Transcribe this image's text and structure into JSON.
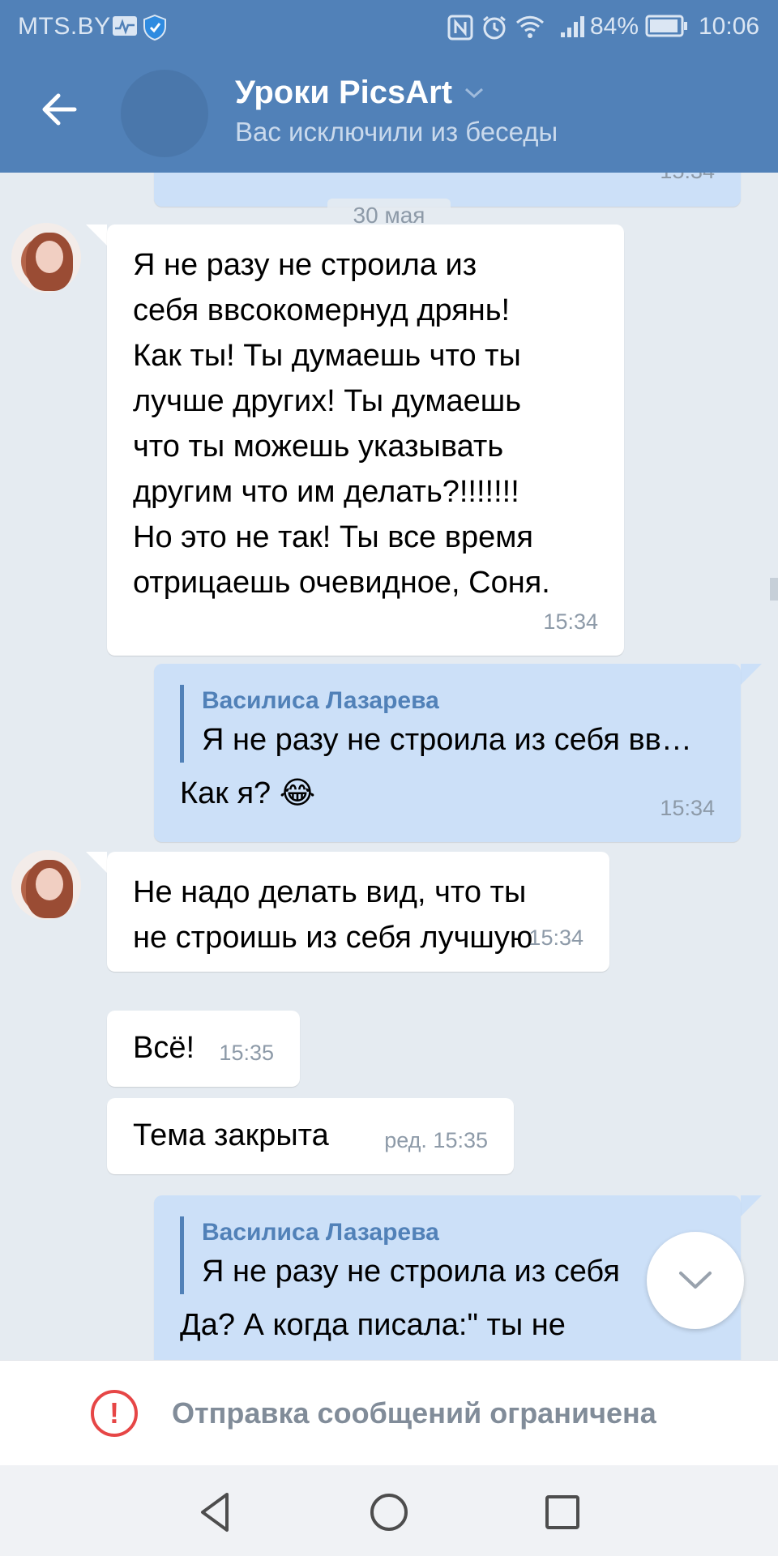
{
  "status_bar": {
    "carrier": "MTS.BY",
    "battery": "84%",
    "time": "10:06"
  },
  "header": {
    "title": "Уроки PicsArt",
    "subtitle": "Вас исключили из беседы"
  },
  "messages": {
    "prev_cut_time": "15:34",
    "date_separator": "30 мая",
    "m1": {
      "lines": [
        "Я не разу не строила из",
        "себя ввсокомернуд дрянь!",
        "Как ты! Ты думаешь что ты",
        "лучше других! Ты думаешь",
        "что ты можешь указывать",
        "другим что им делать?!!!!!!!",
        "Но это не так! Ты все время",
        "отрицаешь очевидное, Соня."
      ],
      "time": "15:34"
    },
    "m2": {
      "quote_author": "Василиса Лазарева",
      "quote_text": "Я не разу не строила из себя вв…",
      "text": "Как я? 😂",
      "time": "15:34"
    },
    "m3": {
      "lines": [
        "Не надо делать вид, что ты",
        "не строишь из себя лучшую"
      ],
      "time": "15:34"
    },
    "m4": {
      "text": "Всё!",
      "time": "15:35"
    },
    "m5": {
      "text": "Тема закрыта",
      "time": "ред. 15:35"
    },
    "m6": {
      "quote_author": "Василиса Лазарева",
      "quote_text": "Я не разу не строила из себя",
      "text": "Да? А когда писала:\" ты не"
    }
  },
  "restriction": {
    "text": "Отправка сообщений ограничена"
  },
  "colors": {
    "header_bg": "#5181b8",
    "chat_bg": "#e5ebf1",
    "outgoing_bg": "#cce0f8",
    "warning": "#e64646"
  }
}
